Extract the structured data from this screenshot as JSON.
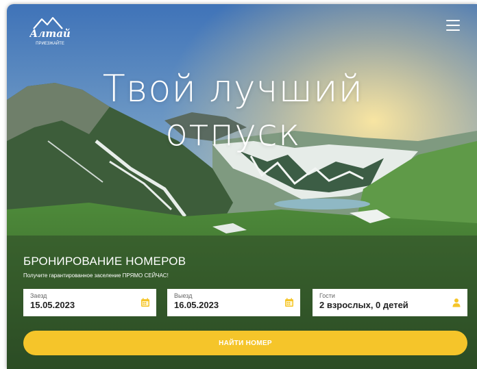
{
  "brand": {
    "logo_text": "Алтай",
    "logo_sub": "ПРИЕЗЖАЙТЕ"
  },
  "hero": {
    "title": "Твой лучший отпуск"
  },
  "booking": {
    "title": "БРОНИРОВАНИЕ НОМЕРОВ",
    "subtitle": "Получите гарантированное заселение ПРЯМО СЕЙЧАС!",
    "checkin": {
      "label": "Заезд",
      "value": "15.05.2023"
    },
    "checkout": {
      "label": "Выезд",
      "value": "16.05.2023"
    },
    "guests": {
      "label": "Гости",
      "value": "2 взрослых, 0 детей"
    },
    "search_label": "НАЙТИ НОМЕР"
  },
  "colors": {
    "accent": "#f5c52a",
    "field_bg": "#ffffff",
    "icon": "#f5c52a"
  },
  "icons": {
    "menu": "hamburger-menu-icon",
    "date": "calendar-icon",
    "guests": "user-icon"
  }
}
